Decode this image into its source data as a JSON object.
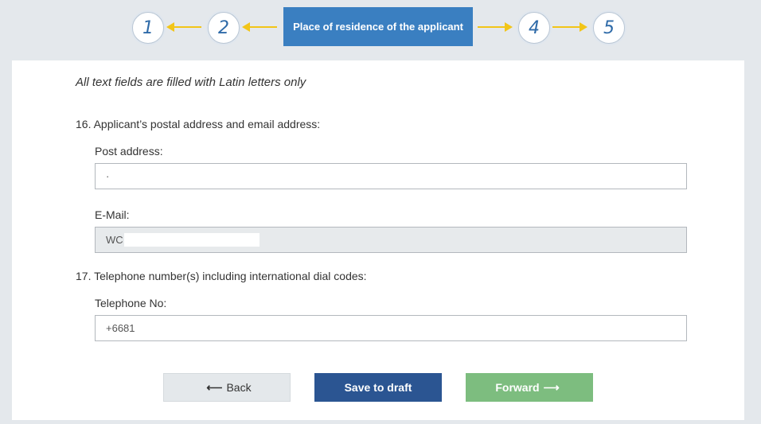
{
  "stepper": {
    "steps": [
      "1",
      "2",
      "Place of residence of the applicant",
      "4",
      "5"
    ],
    "current_index": 2,
    "arrow_color": "#f2c518",
    "current_color": "#3a7fc1"
  },
  "form": {
    "note": "All text fields are filled with Latin letters only",
    "section16": {
      "title": "16. Applicant’s postal address and email address:",
      "post_address_label": "Post address:",
      "post_address_value": "·",
      "email_label": "E-Mail:",
      "email_value": "WC"
    },
    "section17": {
      "title": "17. Telephone number(s) including international dial codes:",
      "phone_label": "Telephone No:",
      "phone_value": "+6681"
    }
  },
  "buttons": {
    "back_label": "Back",
    "back_icon": "arrow-left-icon",
    "draft_label": "Save to draft",
    "forward_label": "Forward",
    "forward_icon": "arrow-right-icon",
    "back_color": "#e4e8eb",
    "draft_color": "#2b5592",
    "forward_color": "#7dbd7f"
  }
}
